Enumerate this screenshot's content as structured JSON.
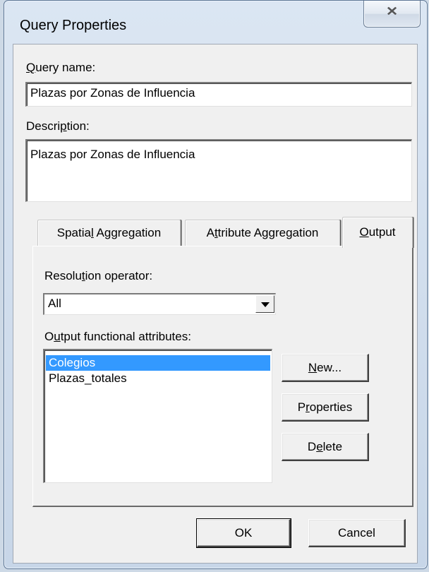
{
  "window": {
    "title": "Query Properties",
    "close_glyph": "✕"
  },
  "query_name": {
    "label_ul": "Q",
    "label_rest": "uery name:",
    "value": "Plazas por Zonas de Influencia"
  },
  "description": {
    "label_pre": "Descri",
    "label_ul": "p",
    "label_post": "tion:",
    "value": "Plazas por Zonas de Influencia"
  },
  "tabs": [
    {
      "pre": "Spatia",
      "ul": "l",
      "post": " Aggregation",
      "active": false
    },
    {
      "pre": "A",
      "ul": "t",
      "post": "tribute Aggregation",
      "active": false
    },
    {
      "pre": "",
      "ul": "O",
      "post": "utput",
      "active": true
    }
  ],
  "resolution": {
    "label_pre": "Resolu",
    "label_ul": "t",
    "label_post": "ion operator:",
    "selected": "All"
  },
  "output_attrs": {
    "label_pre": "O",
    "label_ul": "u",
    "label_post": "tput functional attributes:",
    "items": [
      "Colegios",
      "Plazas_totales"
    ],
    "selected_index": 0
  },
  "buttons": {
    "new_ul": "N",
    "new_rest": "ew...",
    "props_pre": "P",
    "props_ul": "r",
    "props_post": "operties",
    "delete_pre": "D",
    "delete_ul": "e",
    "delete_post": "lete",
    "ok": "OK",
    "cancel": "Cancel"
  },
  "colors": {
    "selection": "#3399ff",
    "window_frame": "#cfdcec",
    "client": "#f0f0f0"
  }
}
